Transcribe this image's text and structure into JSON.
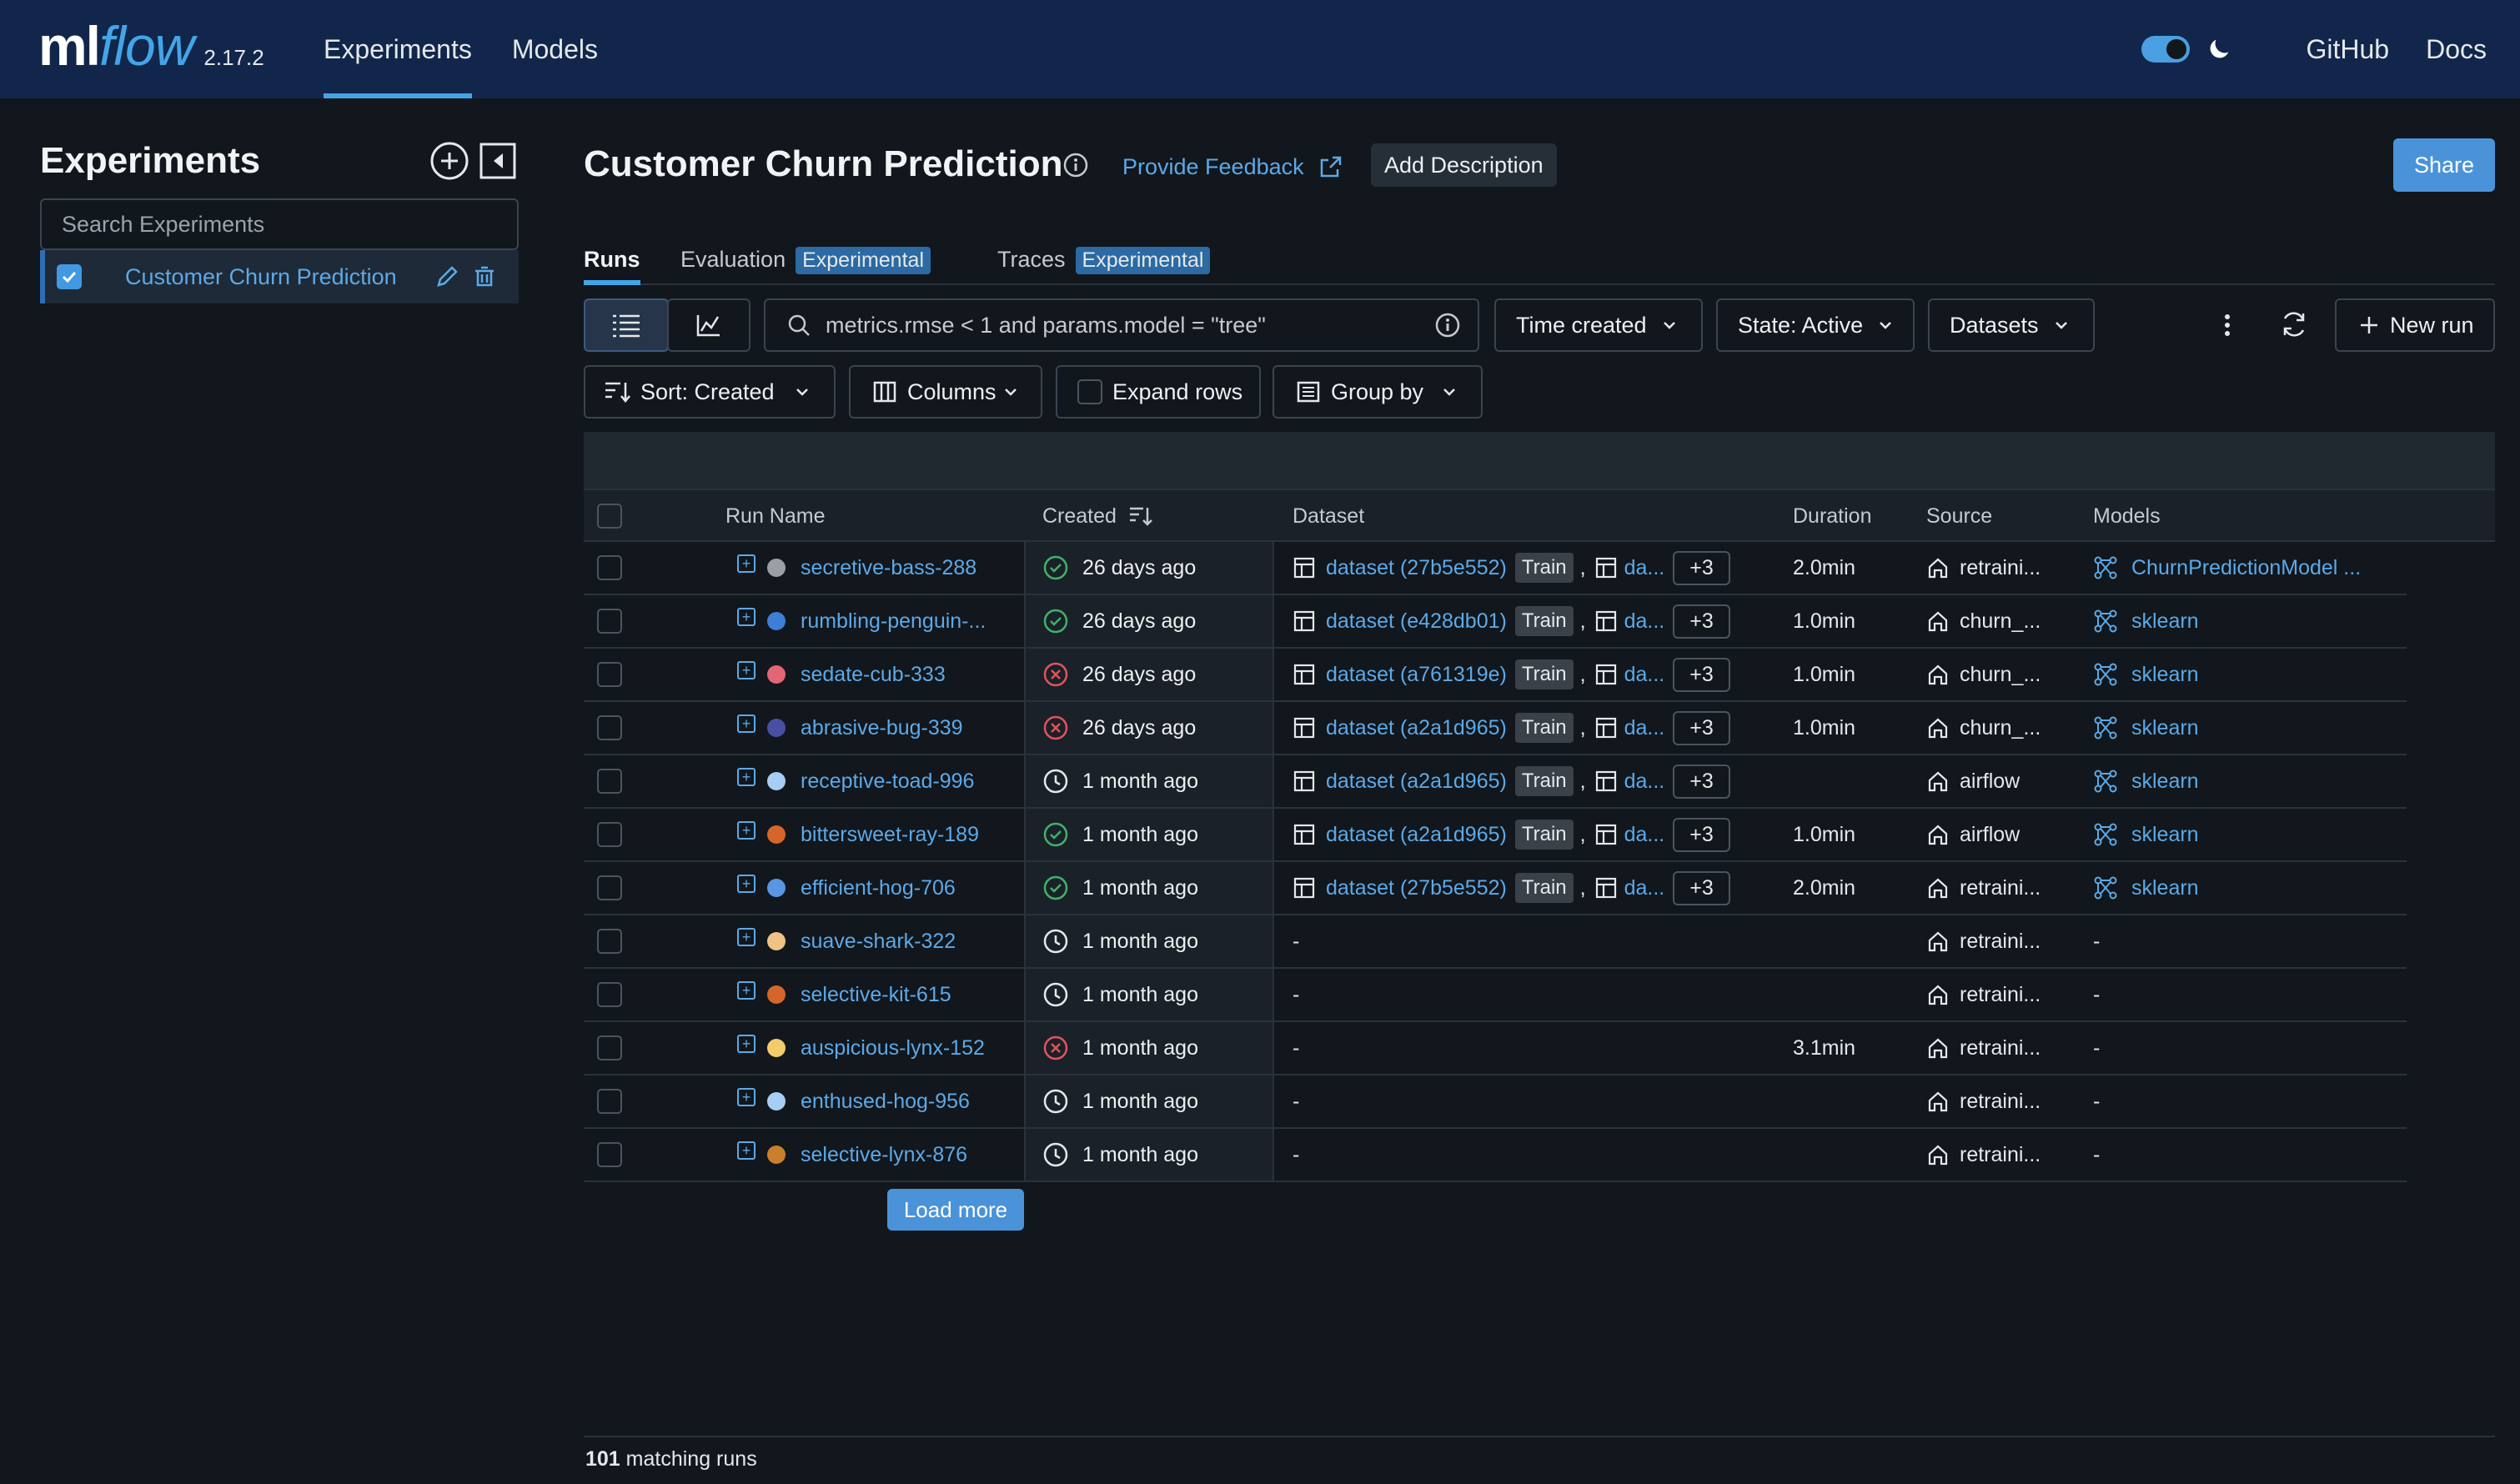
{
  "topbar": {
    "logo_ml": "ml",
    "logo_flow": "flow",
    "version": "2.17.2",
    "nav": [
      {
        "label": "Experiments"
      },
      {
        "label": "Models"
      }
    ],
    "links": [
      {
        "label": "GitHub"
      },
      {
        "label": "Docs"
      }
    ],
    "theme_toggle": "dark"
  },
  "sidebar": {
    "title": "Experiments",
    "search_placeholder": "Search Experiments",
    "experiments": [
      {
        "label": "Customer Churn Prediction",
        "checked": true
      }
    ]
  },
  "main": {
    "title": "Customer Churn Prediction",
    "feedback_label": "Provide Feedback",
    "add_description_label": "Add Description",
    "share_label": "Share",
    "tabs": [
      {
        "label": "Runs",
        "tag": ""
      },
      {
        "label": "Evaluation",
        "tag": "Experimental"
      },
      {
        "label": "Traces",
        "tag": "Experimental"
      }
    ],
    "search_value": "metrics.rmse < 1 and params.model = \"tree\"",
    "filters": {
      "time_created": "Time created",
      "state": "State: Active",
      "datasets": "Datasets",
      "new_run": "New run",
      "sort": "Sort: Created",
      "columns": "Columns",
      "expand_rows": "Expand rows",
      "group_by": "Group by"
    },
    "columns": {
      "run_name": "Run Name",
      "created": "Created",
      "dataset": "Dataset",
      "duration": "Duration",
      "source": "Source",
      "models": "Models"
    },
    "rows": [
      {
        "name": "secretive-bass-288",
        "color": "#9aa0a6",
        "status": "success",
        "created": "26 days ago",
        "dataset": "dataset (27b5e552)",
        "badge": "Train",
        "more": "+3",
        "duration": "2.0min",
        "source": "retraini...",
        "model": "ChurnPredictionModel ..."
      },
      {
        "name": "rumbling-penguin-...",
        "color": "#3d7ed6",
        "status": "success",
        "created": "26 days ago",
        "dataset": "dataset (e428db01)",
        "badge": "Train",
        "more": "+3",
        "duration": "1.0min",
        "source": "churn_...",
        "model": "sklearn"
      },
      {
        "name": "sedate-cub-333",
        "color": "#e36677",
        "status": "failed",
        "created": "26 days ago",
        "dataset": "dataset (a761319e)",
        "badge": "Train",
        "more": "+3",
        "duration": "1.0min",
        "source": "churn_...",
        "model": "sklearn"
      },
      {
        "name": "abrasive-bug-339",
        "color": "#4a4fa3",
        "status": "failed",
        "created": "26 days ago",
        "dataset": "dataset (a2a1d965)",
        "badge": "Train",
        "more": "+3",
        "duration": "1.0min",
        "source": "churn_...",
        "model": "sklearn"
      },
      {
        "name": "receptive-toad-996",
        "color": "#a8cdf3",
        "status": "scheduled",
        "created": "1 month ago",
        "dataset": "dataset (a2a1d965)",
        "badge": "Train",
        "more": "+3",
        "duration": "",
        "source": "airflow",
        "model": "sklearn"
      },
      {
        "name": "bittersweet-ray-189",
        "color": "#d4662c",
        "status": "success",
        "created": "1 month ago",
        "dataset": "dataset (a2a1d965)",
        "badge": "Train",
        "more": "+3",
        "duration": "1.0min",
        "source": "airflow",
        "model": "sklearn"
      },
      {
        "name": "efficient-hog-706",
        "color": "#5a96e3",
        "status": "success",
        "created": "1 month ago",
        "dataset": "dataset (27b5e552)",
        "badge": "Train",
        "more": "+3",
        "duration": "2.0min",
        "source": "retraini...",
        "model": "sklearn"
      },
      {
        "name": "suave-shark-322",
        "color": "#efc285",
        "status": "scheduled",
        "created": "1 month ago",
        "dataset": "-",
        "badge": "",
        "more": "",
        "duration": "",
        "source": "retraini...",
        "model": "-"
      },
      {
        "name": "selective-kit-615",
        "color": "#d4662c",
        "status": "scheduled",
        "created": "1 month ago",
        "dataset": "-",
        "badge": "",
        "more": "",
        "duration": "",
        "source": "retraini...",
        "model": "-"
      },
      {
        "name": "auspicious-lynx-152",
        "color": "#f2cb6a",
        "status": "failed",
        "created": "1 month ago",
        "dataset": "-",
        "badge": "",
        "more": "",
        "duration": "3.1min",
        "source": "retraini...",
        "model": "-"
      },
      {
        "name": "enthused-hog-956",
        "color": "#a8cdf3",
        "status": "scheduled",
        "created": "1 month ago",
        "dataset": "-",
        "badge": "",
        "more": "",
        "duration": "",
        "source": "retraini...",
        "model": "-"
      },
      {
        "name": "selective-lynx-876",
        "color": "#c97f2e",
        "status": "scheduled",
        "created": "1 month ago",
        "dataset": "-",
        "badge": "",
        "more": "",
        "duration": "",
        "source": "retraini...",
        "model": "-"
      }
    ],
    "load_more_label": "Load more",
    "footer_count": "101",
    "footer_suffix": "matching runs"
  },
  "colors": {
    "topbar": "#11264a",
    "background": "#11171c",
    "accent": "#43a5e8",
    "link": "#5da9e8",
    "success": "#3fb26a",
    "failed": "#e0535e"
  }
}
